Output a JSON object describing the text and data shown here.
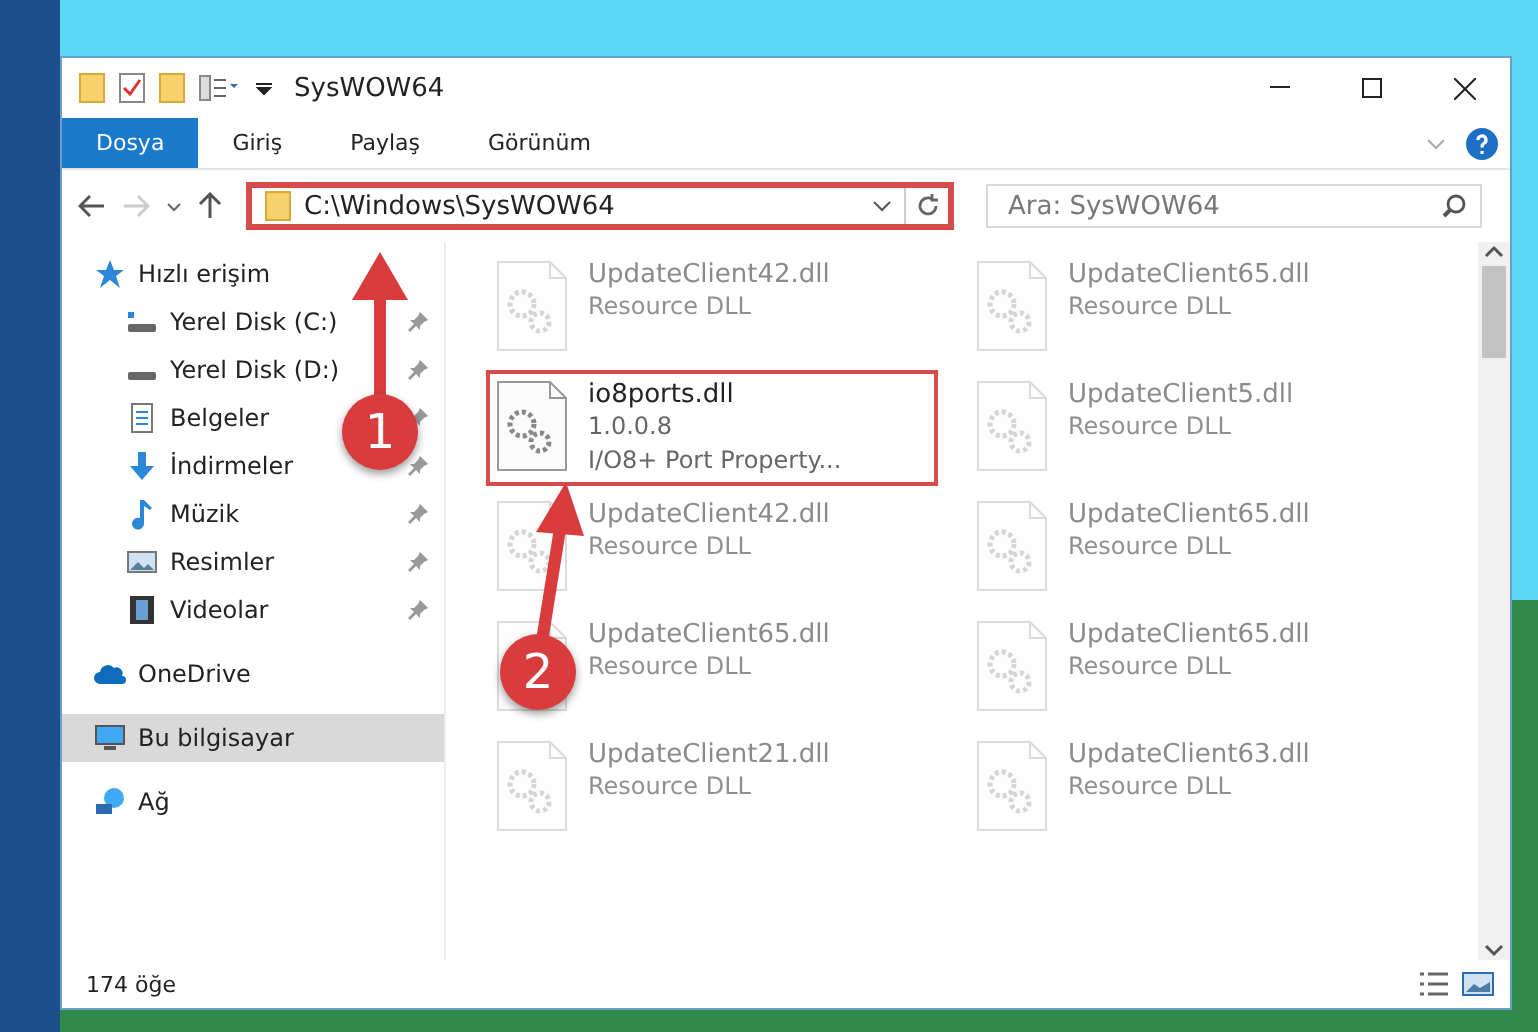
{
  "window": {
    "title": "SysWOW64"
  },
  "ribbon_tabs": [
    {
      "label": "Dosya",
      "selected": true
    },
    {
      "label": "Giriş",
      "selected": false
    },
    {
      "label": "Paylaş",
      "selected": false
    },
    {
      "label": "Görünüm",
      "selected": false
    }
  ],
  "address_bar": {
    "path": "C:\\Windows\\SysWOW64",
    "highlighted": true
  },
  "search": {
    "placeholder": "Ara: SysWOW64"
  },
  "nav_pane": {
    "items": [
      {
        "label": "Hızlı erişim",
        "kind": "star",
        "selected": false,
        "children": [
          {
            "label": "Yerel Disk (C:)",
            "kind": "drive-c",
            "pinned": true
          },
          {
            "label": "Yerel Disk (D:)",
            "kind": "drive",
            "pinned": true
          },
          {
            "label": "Belgeler",
            "kind": "document",
            "pinned": true
          },
          {
            "label": "İndirmeler",
            "kind": "download",
            "pinned": true
          },
          {
            "label": "Müzik",
            "kind": "music",
            "pinned": true
          },
          {
            "label": "Resimler",
            "kind": "picture",
            "pinned": true
          },
          {
            "label": "Videolar",
            "kind": "video",
            "pinned": true
          }
        ]
      },
      {
        "label": "OneDrive",
        "kind": "cloud",
        "selected": false
      },
      {
        "label": "Bu bilgisayar",
        "kind": "pc",
        "selected": true
      },
      {
        "label": "Ağ",
        "kind": "network",
        "selected": false
      }
    ]
  },
  "files": [
    {
      "name": "UpdateClient42.dll",
      "lines": [
        "Resource DLL"
      ],
      "dimmed": true,
      "highlighted": false
    },
    {
      "name": "UpdateClient65.dll",
      "lines": [
        "Resource DLL"
      ],
      "dimmed": true,
      "highlighted": false
    },
    {
      "name": "io8ports.dll",
      "lines": [
        "1.0.0.8",
        "I/O8+ Port Property..."
      ],
      "dimmed": false,
      "highlighted": true
    },
    {
      "name": "UpdateClient5.dll",
      "lines": [
        "Resource DLL"
      ],
      "dimmed": true,
      "highlighted": false
    },
    {
      "name": "UpdateClient42.dll",
      "lines": [
        "Resource DLL"
      ],
      "dimmed": true,
      "highlighted": false
    },
    {
      "name": "UpdateClient65.dll",
      "lines": [
        "Resource DLL"
      ],
      "dimmed": true,
      "highlighted": false
    },
    {
      "name": "UpdateClient65.dll",
      "lines": [
        "Resource DLL"
      ],
      "dimmed": true,
      "highlighted": false
    },
    {
      "name": "UpdateClient65.dll",
      "lines": [
        "Resource DLL"
      ],
      "dimmed": true,
      "highlighted": false
    },
    {
      "name": "UpdateClient21.dll",
      "lines": [
        "Resource DLL"
      ],
      "dimmed": true,
      "highlighted": false
    },
    {
      "name": "UpdateClient63.dll",
      "lines": [
        "Resource DLL"
      ],
      "dimmed": true,
      "highlighted": false
    }
  ],
  "status_bar": {
    "item_count": "174 öğe"
  },
  "annotations": [
    {
      "label": "1"
    },
    {
      "label": "2"
    }
  ]
}
